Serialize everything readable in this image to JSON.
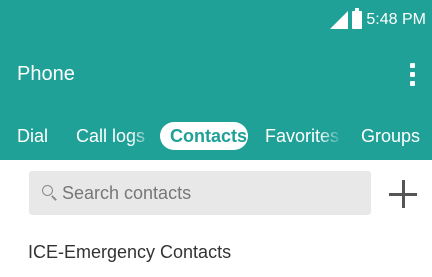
{
  "status_bar": {
    "time": "5:48 PM",
    "signal_icon": "signal-icon",
    "battery_icon": "battery-icon"
  },
  "app_bar": {
    "title": "Phone",
    "menu_icon": "overflow-menu-icon"
  },
  "tabs": [
    {
      "label": "Dial",
      "selected": false
    },
    {
      "label": "Call logs",
      "selected": false
    },
    {
      "label": "Contacts",
      "selected": true
    },
    {
      "label": "Favorites",
      "selected": false
    },
    {
      "label": "Groups",
      "selected": false
    }
  ],
  "search": {
    "placeholder": "Search contacts",
    "icon": "search-icon"
  },
  "add_contact": {
    "icon": "add-icon"
  },
  "section": {
    "title": "ICE-Emergency Contacts"
  },
  "colors": {
    "primary": "#1fa197",
    "tab_selected_bg": "#ffffff",
    "search_bg": "#e8e8e8",
    "text_dark": "#333333"
  }
}
